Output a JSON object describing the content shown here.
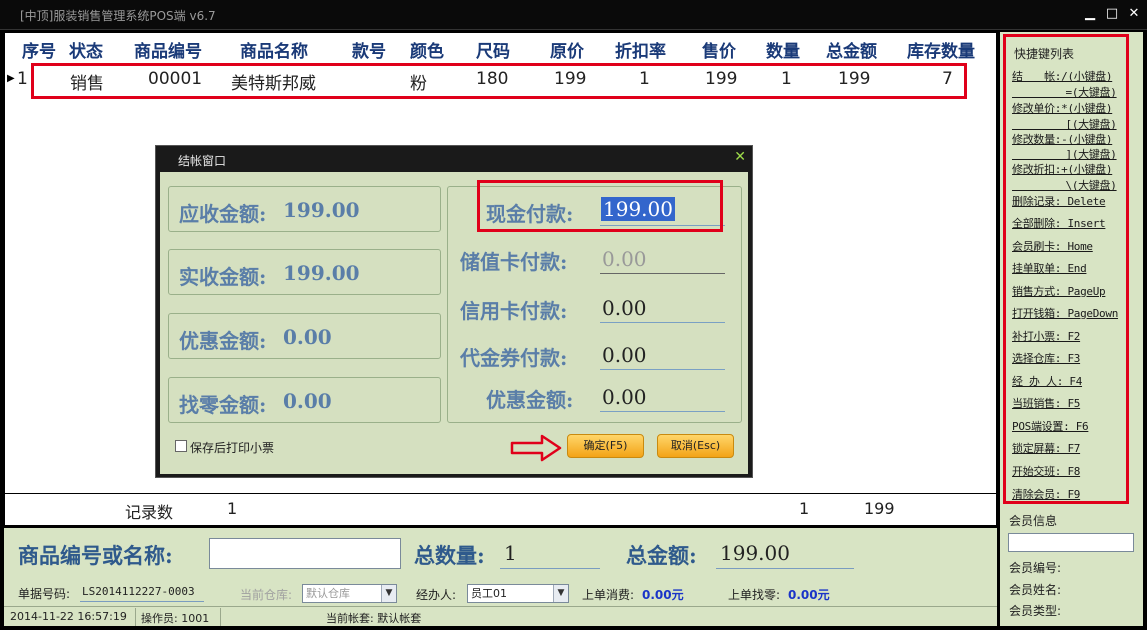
{
  "window": {
    "title": "[中顶]服装销售管理系统POS端 v6.7",
    "btn_min": "▁",
    "btn_max": "□",
    "btn_close": "✕"
  },
  "table": {
    "headers": [
      "序号",
      "状态",
      "商品编号",
      "商品名称",
      "款号",
      "颜色",
      "尺码",
      "原价",
      "折扣率",
      "售价",
      "数量",
      "总金额",
      "库存数量"
    ],
    "rows": [
      {
        "index": "1",
        "status": "销售",
        "code": "00001",
        "name": "美特斯邦威",
        "style": "",
        "color": "粉",
        "size": "180",
        "orig_price": "199",
        "discount": "1",
        "price": "199",
        "qty": "1",
        "total": "199",
        "stock": "7"
      }
    ],
    "summary": {
      "label": "记录数",
      "count": "1",
      "qty": "1",
      "total": "199"
    }
  },
  "bottom": {
    "search_label": "商品编号或名称:",
    "search_value": "",
    "total_qty_label": "总数量:",
    "total_qty_value": "1",
    "total_amount_label": "总金额:",
    "total_amount_value": "199.00",
    "order_no_label": "单据号码:",
    "order_no_value": "LS2014112227-0003",
    "warehouse_label": "当前仓库:",
    "warehouse_value": "默认仓库",
    "handler_label": "经办人:",
    "handler_value": "员工01",
    "last_spend_label": "上单消费:",
    "last_spend_value": "0.00元",
    "last_change_label": "上单找零:",
    "last_change_value": "0.00元"
  },
  "statusbar": {
    "datetime": "2014-11-22 16:57:19",
    "operator": "操作员: 1001",
    "account": "当前帐套: 默认帐套"
  },
  "shortcuts": {
    "title": "快捷键列表",
    "items": [
      "结　　帐:/(小键盘)",
      "　　　　　=(大键盘)",
      "修改单价:*(小键盘)",
      "　　　　　[(大键盘)",
      "修改数量:-(小键盘)",
      "　　　　　](大键盘)",
      "修改折扣:+(小键盘)",
      "　　　　　\\(大键盘)",
      "删除记录: Delete",
      "全部删除: Insert",
      "会员刷卡: Home",
      "挂单取单: End",
      "销售方式: PageUp",
      "打开钱箱: PageDown",
      "补打小票: F2",
      "选择仓库: F3",
      "经 办 人: F4",
      "当班销售: F5",
      "POS端设置: F6",
      "锁定屏幕: F7",
      "开始交班: F8",
      "清除会员: F9"
    ]
  },
  "member": {
    "title": "会员信息",
    "id_label": "会员编号:",
    "name_label": "会员姓名:",
    "type_label": "会员类型:"
  },
  "dialog": {
    "title": "结帐窗口",
    "close": "✕",
    "receivable_label": "应收金额:",
    "receivable_value": "199.00",
    "received_label": "实收金额:",
    "received_value": "199.00",
    "discount_label": "优惠金额:",
    "discount_value": "0.00",
    "change_label": "找零金额:",
    "change_value": "0.00",
    "cash_label": "现金付款:",
    "cash_value": "199.00",
    "card_label": "储值卡付款:",
    "card_value": "0.00",
    "credit_label": "信用卡付款:",
    "credit_value": "0.00",
    "voucher_label": "代金券付款:",
    "voucher_value": "0.00",
    "discount2_label": "优惠金额:",
    "discount2_value": "0.00",
    "print_checkbox": "保存后打印小票",
    "ok_button": "确定(F5)",
    "cancel_button": "取消(Esc)"
  },
  "colors": {
    "highlight": "#e0001a",
    "panel": "#d8e4c4",
    "label_blue": "#5a7ea8",
    "button_orange": "#f3a317"
  }
}
